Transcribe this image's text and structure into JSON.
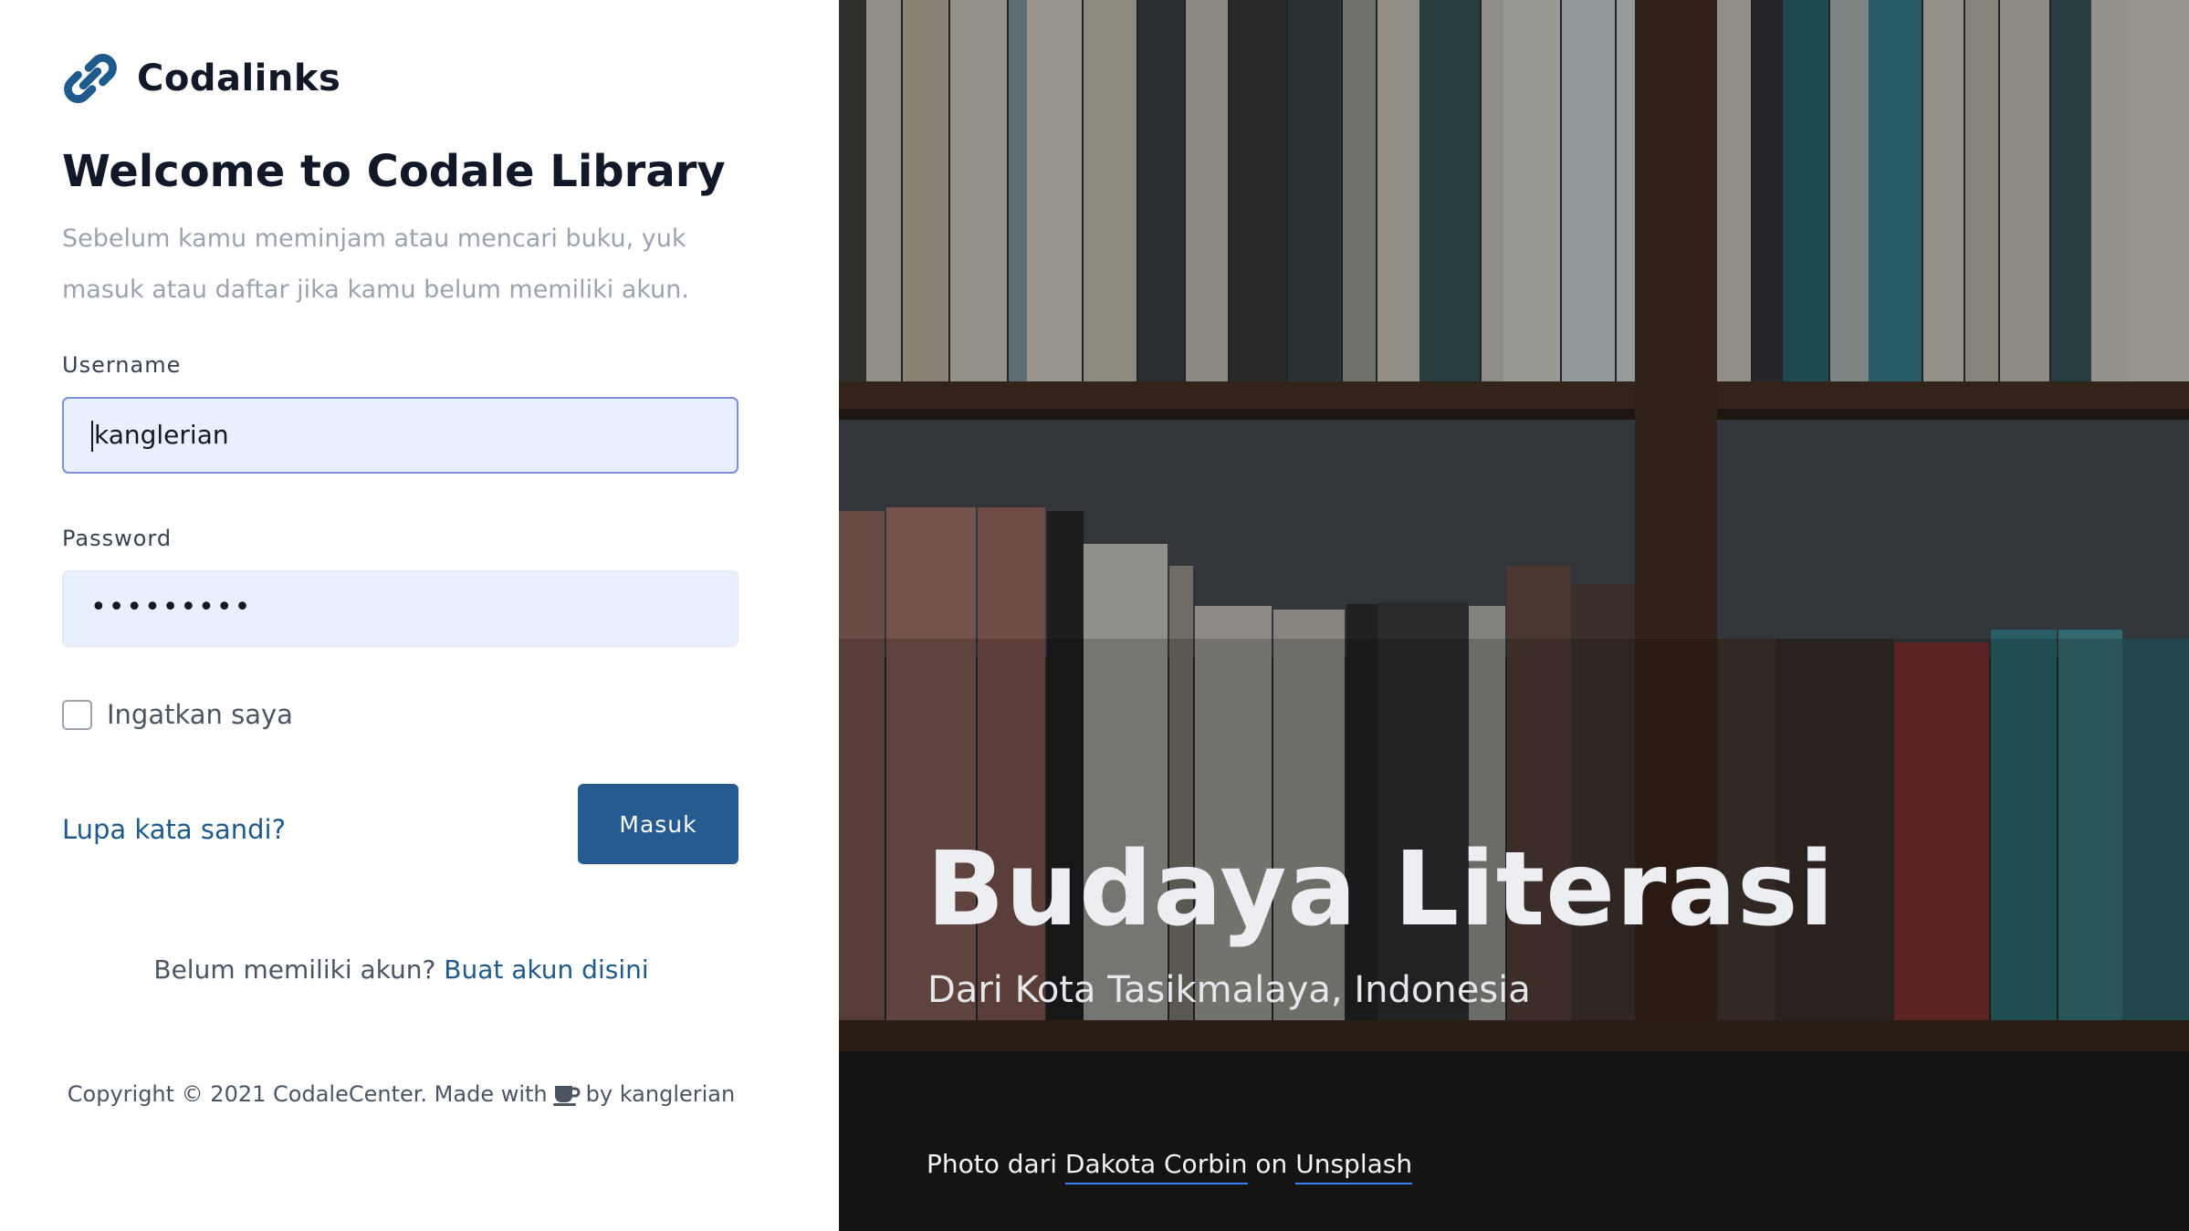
{
  "brand": {
    "name": "Codalinks",
    "logo_icon": "chain-link-icon",
    "logo_color": "#1e5a8c"
  },
  "welcome": {
    "prefix": "Welcome to ",
    "name": "Codale Library"
  },
  "intro": "Sebelum kamu meminjam atau mencari buku, yuk masuk atau daftar jika kamu belum memiliki akun.",
  "form": {
    "username_label": "Username",
    "username_value": "kanglerian",
    "password_label": "Password",
    "password_value": "•••••••••",
    "remember_label": "Ingatkan saya",
    "remember_checked": false,
    "forgot_link": "Lupa kata sandi?",
    "submit_label": "Masuk"
  },
  "register": {
    "prompt": "Belum memiliki akun?",
    "link": "Buat akun disini"
  },
  "footer": {
    "before": "Copyright © 2021 CodaleCenter. Made with",
    "icon": "coffee-cup-icon",
    "after": "by kanglerian"
  },
  "hero": {
    "title": "Budaya Literasi",
    "subtitle": "Dari Kota Tasikmalaya, Indonesia",
    "credit_prefix": "Photo dari",
    "credit_author": "Dakota Corbin",
    "credit_on": "on",
    "credit_site": "Unsplash"
  },
  "colors": {
    "primary": "#255b8e",
    "link": "#1e5a8c",
    "input_bg": "#e8f0fe",
    "muted_text": "#9ca3af"
  }
}
